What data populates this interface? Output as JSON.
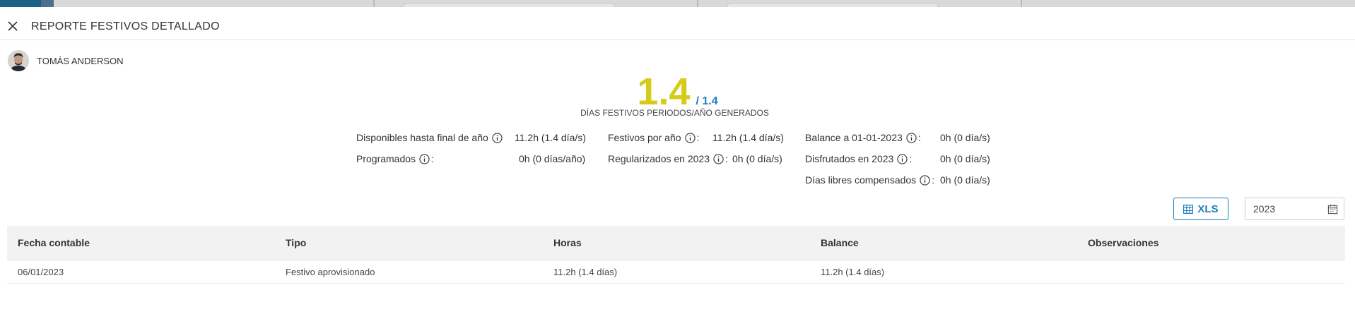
{
  "header": {
    "title": "REPORTE FESTIVOS DETALLADO"
  },
  "user": {
    "name": "TOMÁS ANDERSON"
  },
  "summary": {
    "value": "1.4",
    "total": "/ 1.4",
    "caption": "DÍAS FESTIVOS PERIODOS/AÑO GENERADOS"
  },
  "stats": {
    "disponibles": {
      "label": "Disponibles hasta final de año",
      "value": "11.2h  (1.4 día/s)"
    },
    "programados": {
      "label": "Programados",
      "value": "0h  (0 días/año)"
    },
    "festivos_por_ano": {
      "label": "Festivos por año",
      "value": "11.2h  (1.4 día/s)"
    },
    "regularizados": {
      "label": "Regularizados en 2023",
      "value": "0h  (0 día/s)"
    },
    "balance": {
      "label": "Balance a 01-01-2023",
      "value": "0h  (0 día/s)"
    },
    "disfrutados": {
      "label": "Disfrutados en 2023",
      "value": "0h  (0 día/s)"
    },
    "compensados": {
      "label": "Días libres compensados",
      "value": "0h  (0 día/s)"
    }
  },
  "toolbar": {
    "xls_label": "XLS",
    "year_value": "2023"
  },
  "table": {
    "columns": [
      "Fecha contable",
      "Tipo",
      "Horas",
      "Balance",
      "Observaciones"
    ],
    "rows": [
      [
        "06/01/2023",
        "Festivo aprovisionado",
        "11.2h (1.4 días)",
        "11.2h (1.4 días)",
        ""
      ]
    ]
  },
  "colors": {
    "accent": "#1a7fbf",
    "highlight": "#d6cc17"
  }
}
